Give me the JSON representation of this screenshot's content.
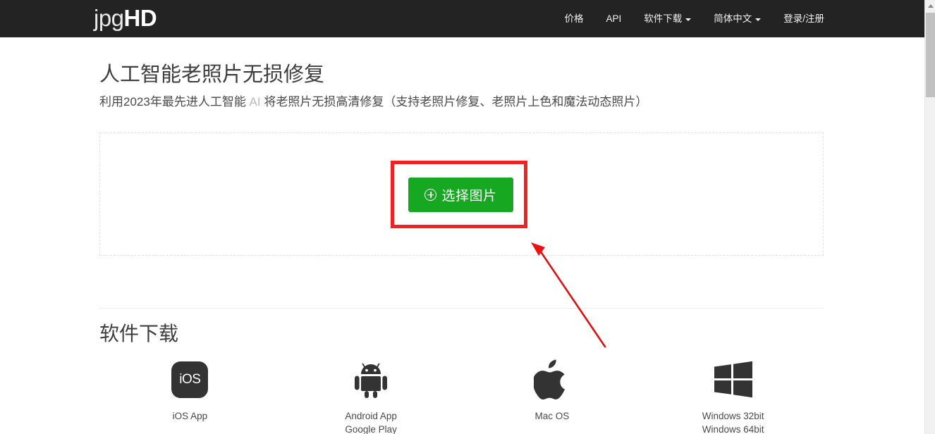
{
  "header": {
    "brand_light": "jpg",
    "brand_bold": "HD",
    "nav": [
      {
        "label": "价格",
        "has_caret": false
      },
      {
        "label": "API",
        "has_caret": false
      },
      {
        "label": "软件下载",
        "has_caret": true
      },
      {
        "label": "简体中文",
        "has_caret": true
      },
      {
        "label": "登录/注册",
        "has_caret": false
      }
    ]
  },
  "hero": {
    "title": "人工智能老照片无损修复",
    "sub_before": "利用2023年最先进人工智能 ",
    "sub_ai": "AI",
    "sub_after": " 将老照片无损高清修复（支持老照片修复、老照片上色和魔法动态照片）"
  },
  "upload": {
    "button_label": "选择图片",
    "button_icon": "plus-circle-icon",
    "button_color": "#16a821"
  },
  "annotation": {
    "box_color": "#ee2222",
    "arrow_color": "#dd1111"
  },
  "downloads": {
    "section_title": "软件下载",
    "items": [
      {
        "icon": "ios-app-icon",
        "icon_text": "iOS",
        "line1": "iOS App",
        "line2": ""
      },
      {
        "icon": "android-robot-icon",
        "icon_text": "",
        "line1": "Android App",
        "line2": "Google Play"
      },
      {
        "icon": "apple-logo-icon",
        "icon_text": "",
        "line1": "Mac OS",
        "line2": ""
      },
      {
        "icon": "windows-logo-icon",
        "icon_text": "",
        "line1": "Windows 32bit",
        "line2": "Windows 64bit"
      }
    ]
  },
  "scrollbar": {
    "up_arrow_icon": "chevron-up-icon"
  }
}
